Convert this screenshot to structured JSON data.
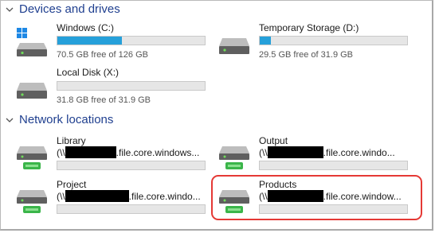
{
  "sections": {
    "devices": {
      "title": "Devices and drives"
    },
    "network": {
      "title": "Network locations"
    }
  },
  "drives": [
    {
      "name": "Windows (C:)",
      "free_text": "70.5 GB free of 126 GB",
      "used_fraction": 0.44,
      "accent": "#26a0da"
    },
    {
      "name": "Temporary Storage (D:)",
      "free_text": "29.5 GB free of 31.9 GB",
      "used_fraction": 0.075,
      "accent": "#26a0da"
    },
    {
      "name": "Local Disk (X:)",
      "free_text": "31.8 GB free of 31.9 GB",
      "used_fraction": 0.0,
      "accent": "#26a0da"
    }
  ],
  "network_locations": [
    {
      "name": "Library",
      "path_prefix": "(\\\\",
      "path_suffix": ".file.core.windows..."
    },
    {
      "name": "Output",
      "path_prefix": "(\\\\",
      "path_suffix": ".file.core.windo..."
    },
    {
      "name": "Project",
      "path_prefix": "(\\\\",
      "path_suffix": ".file.core.windo..."
    },
    {
      "name": "Products",
      "path_prefix": "(\\\\",
      "path_suffix": ".file.core.window..."
    }
  ],
  "colors": {
    "section_header": "#1f3f8f",
    "usage_bar": "#26a0da",
    "network_drive_green": "#3bb54a",
    "highlight_outline": "#e53935"
  },
  "icons": {
    "chevron": "chevron-down-icon",
    "os_drive": "windows-drive-icon",
    "local_drive": "hard-drive-icon",
    "network_drive": "network-drive-icon"
  }
}
